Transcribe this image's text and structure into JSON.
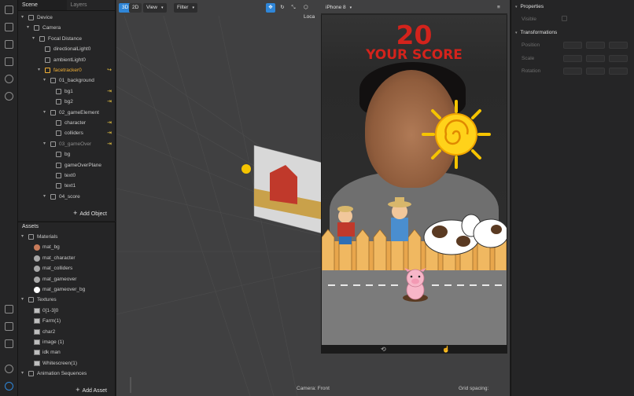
{
  "scene_panel": {
    "tabs": [
      "Scene",
      "Layers"
    ],
    "tree": [
      {
        "label": "Device",
        "arrow": "▾",
        "depth": 0,
        "icon": "device-icon"
      },
      {
        "label": "Camera",
        "arrow": "▾",
        "depth": 1,
        "icon": "camera-icon"
      },
      {
        "label": "Focal Distance",
        "arrow": "▾",
        "depth": 2,
        "icon": "focal-distance-icon"
      },
      {
        "label": "directionalLight0",
        "arrow": "",
        "depth": 3,
        "icon": "light-icon"
      },
      {
        "label": "ambientLight0",
        "arrow": "",
        "depth": 3,
        "icon": "light-icon"
      },
      {
        "label": "facetracker0",
        "arrow": "▾",
        "depth": 3,
        "icon": "facetracker-icon",
        "accent": true,
        "flag": "↪"
      },
      {
        "label": "01_background",
        "arrow": "▾",
        "depth": 4,
        "icon": "group-icon"
      },
      {
        "label": "bg1",
        "arrow": "",
        "depth": 5,
        "icon": "eye-icon",
        "flag": "⇥"
      },
      {
        "label": "bg2",
        "arrow": "",
        "depth": 5,
        "icon": "eye-icon",
        "flag": "⇥"
      },
      {
        "label": "02_gameElement",
        "arrow": "▾",
        "depth": 4,
        "icon": "group-icon"
      },
      {
        "label": "character",
        "arrow": "",
        "depth": 5,
        "icon": "eye-icon",
        "flag": "⇥"
      },
      {
        "label": "colliders",
        "arrow": "",
        "depth": 5,
        "icon": "eye-icon",
        "flag": "⇥"
      },
      {
        "label": "03_gameOver",
        "arrow": "▾",
        "depth": 4,
        "icon": "group-icon",
        "dim": true,
        "flag": "⇥"
      },
      {
        "label": "bg",
        "arrow": "",
        "depth": 5,
        "icon": "rect-icon"
      },
      {
        "label": "gameOverPlane",
        "arrow": "",
        "depth": 5,
        "icon": "eye-icon"
      },
      {
        "label": "text0",
        "arrow": "",
        "depth": 5,
        "icon": "text-icon"
      },
      {
        "label": "text1",
        "arrow": "",
        "depth": 5,
        "icon": "text-icon"
      },
      {
        "label": "04_score",
        "arrow": "▾",
        "depth": 4,
        "icon": "group-icon"
      }
    ],
    "add_object": "Add Object"
  },
  "assets_panel": {
    "title": "Assets",
    "groups": [
      {
        "label": "Materials",
        "items": [
          {
            "label": "mat_bg",
            "swatch": "#c87b5a"
          },
          {
            "label": "mat_character",
            "swatch": "#a8a8a8"
          },
          {
            "label": "mat_colliders",
            "swatch": "#a8a8a8"
          },
          {
            "label": "mat_gameover",
            "swatch": "#a8a8a8"
          },
          {
            "label": "mat_gameover_bg",
            "swatch": "#ffffff"
          }
        ]
      },
      {
        "label": "Textures",
        "items": [
          {
            "label": "0[1-3]0"
          },
          {
            "label": "Farm(1)"
          },
          {
            "label": "char2"
          },
          {
            "label": "image (1)"
          },
          {
            "label": "idk man"
          },
          {
            "label": "Whitescreen(1)"
          }
        ]
      },
      {
        "label": "Animation Sequences",
        "items": []
      }
    ],
    "add_asset": "Add Asset"
  },
  "viewport": {
    "toolbar": {
      "mode_3d": "3D",
      "mode_2d": "2D",
      "view": "View",
      "filter": "Filter",
      "local": "Loca",
      "device": "iPhone 8"
    },
    "game": {
      "score": "20",
      "score_label": "YOUR SCORE"
    },
    "footer": {
      "camera": "Camera: Front",
      "grid": "Grid spacing:"
    }
  },
  "properties_panel": {
    "title": "Properties",
    "visible_label": "Visible",
    "transformations": "Transformations",
    "fields": [
      "Position",
      "Scale",
      "Rotation"
    ]
  },
  "colors": {
    "accent": "#2f86d8",
    "selection": "#f2b035",
    "score_red": "#d3231c"
  }
}
